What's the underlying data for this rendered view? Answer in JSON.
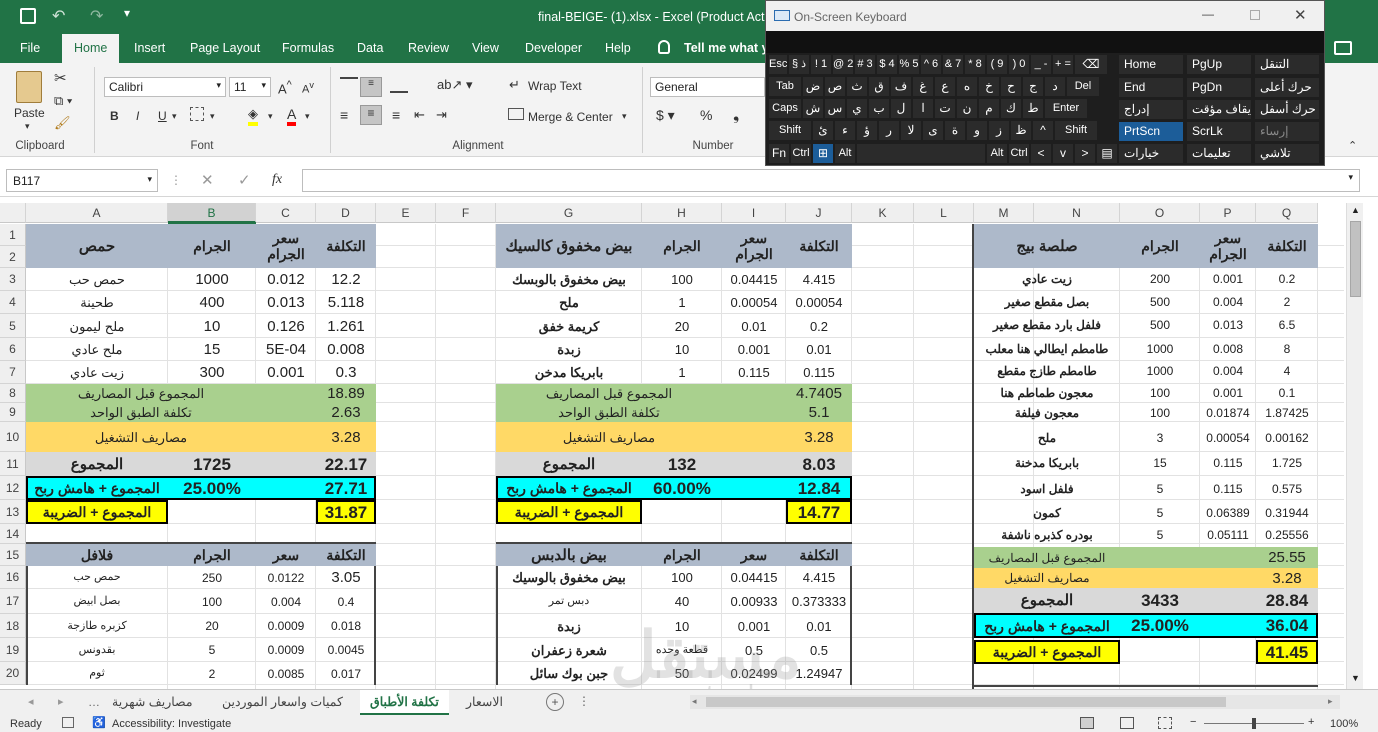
{
  "title_bar": {
    "title": "final-BEIGE- (1).xlsx  -  Excel (Product Activ"
  },
  "menu": [
    "File",
    "Home",
    "Insert",
    "Page Layout",
    "Formulas",
    "Data",
    "Review",
    "View",
    "Developer",
    "Help",
    "Tell me what yo"
  ],
  "ribbon": {
    "font_name": "Calibri",
    "font_size": "11",
    "wrap_text": "Wrap Text",
    "merge_center": "Merge & Center",
    "number_format": "General",
    "paste": "Paste",
    "bold": "B",
    "italic": "I",
    "underline": "U",
    "groups": {
      "clipboard": "Clipboard",
      "font": "Font",
      "alignment": "Alignment",
      "number": "Number"
    }
  },
  "formula_bar": {
    "name_box": "B117",
    "fx": "fx",
    "value": ""
  },
  "osk": {
    "title": "On-Screen Keyboard",
    "rows": [
      [
        "Esc",
        "§ ذ",
        "! 1",
        "@ 2",
        "# 3",
        "$ 4",
        "% 5",
        "^ 6",
        "& 7",
        "* 8",
        "( 9",
        ") 0",
        "_ -",
        "+ =",
        "⌫"
      ],
      [
        "Tab",
        "ض",
        "ص",
        "ث",
        "ق",
        "ف",
        "غ",
        "ع",
        "ه",
        "خ",
        "ح",
        "ج",
        "د",
        "Del"
      ],
      [
        "Caps",
        "ش",
        "س",
        "ي",
        "ب",
        "ل",
        "ا",
        "ت",
        "ن",
        "م",
        "ك",
        "ط",
        "Enter"
      ],
      [
        "Shift",
        "ئ",
        "ء",
        "ؤ",
        "ر",
        "لا",
        "ى",
        "ة",
        "و",
        "ز",
        "ظ",
        "^",
        "Shift"
      ],
      [
        "Fn",
        "Ctrl",
        "⊞",
        "Alt",
        "",
        "Alt",
        "Ctrl",
        "<",
        "v",
        ">",
        "▤"
      ]
    ],
    "nav": [
      [
        "Home",
        "PgUp",
        "التنقل"
      ],
      [
        "End",
        "PgDn",
        "حرك أعلى"
      ],
      [
        "إدراج",
        "إيقاف مؤقت",
        "حرك أسفل"
      ],
      [
        "PrtScn",
        "ScrLk",
        "إرساء"
      ],
      [
        "خيارات",
        "تعليمات",
        "تلاشي"
      ]
    ]
  },
  "columns": [
    {
      "l": "A",
      "w": 142
    },
    {
      "l": "B",
      "w": 88
    },
    {
      "l": "C",
      "w": 60
    },
    {
      "l": "D",
      "w": 60
    },
    {
      "l": "E",
      "w": 60
    },
    {
      "l": "F",
      "w": 60
    },
    {
      "l": "G",
      "w": 146
    },
    {
      "l": "H",
      "w": 80
    },
    {
      "l": "I",
      "w": 64
    },
    {
      "l": "J",
      "w": 66
    },
    {
      "l": "K",
      "w": 62
    },
    {
      "l": "L",
      "w": 60
    },
    {
      "l": "M",
      "w": 60
    },
    {
      "l": "N",
      "w": 86
    },
    {
      "l": "O",
      "w": 80
    },
    {
      "l": "P",
      "w": 56
    },
    {
      "l": "Q",
      "w": 62
    }
  ],
  "rows": [
    "1",
    "2",
    "3",
    "4",
    "5",
    "6",
    "7",
    "8",
    "9",
    "10",
    "11",
    "12",
    "13",
    "14",
    "15",
    "16",
    "17",
    "18",
    "19",
    "20"
  ],
  "block_hummus": {
    "header": {
      "name": "حمص",
      "gram": "الجرام",
      "price": "سعر\nالجرام",
      "cost": "التكلفة"
    },
    "items": [
      [
        "حمص حب",
        "1000",
        "0.012",
        "12.2"
      ],
      [
        "طحينة",
        "400",
        "0.013",
        "5.118"
      ],
      [
        "ملح ليمون",
        "10",
        "0.126",
        "1.261"
      ],
      [
        "ملح عادي",
        "15",
        "5E-04",
        "0.008"
      ],
      [
        "زيت عادي",
        "300",
        "0.001",
        "0.3"
      ]
    ],
    "before_exp": {
      "label": "المجموع قبل المصاريف",
      "value": "18.89"
    },
    "per_plate": {
      "label": "تكلفة الطبق الواحد",
      "value": "2.63"
    },
    "op_exp": {
      "label": "مصاريف التشغيل",
      "value": "3.28"
    },
    "total": {
      "label": "المجموع",
      "gram": "1725",
      "value": "22.17"
    },
    "margin": {
      "label": "المجموع + هامش ربح",
      "pct": "25.00%",
      "value": "27.71"
    },
    "tax": {
      "label": "المجموع + الضريبة",
      "value": "31.87"
    }
  },
  "block_eggs": {
    "header": {
      "name": "بيض مخفوق كالسيك",
      "gram": "الجرام",
      "price": "سعر\nالجرام",
      "cost": "التكلفة"
    },
    "items": [
      [
        "بيض مخفوق بالوبسك",
        "100",
        "0.04415",
        "4.415"
      ],
      [
        "ملح",
        "1",
        "0.00054",
        "0.00054"
      ],
      [
        "كريمة خفق",
        "20",
        "0.01",
        "0.2"
      ],
      [
        "زبدة",
        "10",
        "0.001",
        "0.01"
      ],
      [
        "بابريكا مدخن",
        "1",
        "0.115",
        "0.115"
      ]
    ],
    "before_exp": {
      "label": "المجموع قبل المصاريف",
      "value": "4.7405"
    },
    "per_plate": {
      "label": "تكلفة الطبق الواحد",
      "value": "5.1"
    },
    "op_exp": {
      "label": "مصاريف التشغيل",
      "value": "3.28"
    },
    "total": {
      "label": "المجموع",
      "gram": "132",
      "value": "8.03"
    },
    "margin": {
      "label": "المجموع + هامش ربح",
      "pct": "60.00%",
      "value": "12.84"
    },
    "tax": {
      "label": "المجموع + الضريبة",
      "value": "14.77"
    }
  },
  "block_salsa": {
    "header": {
      "name": "صلصة بيج",
      "gram": "الجرام",
      "price": "سعر\nالجرام",
      "cost": "التكلفة"
    },
    "items": [
      [
        "زيت عادي",
        "200",
        "0.001",
        "0.2"
      ],
      [
        "بصل مقطع صغير",
        "500",
        "0.004",
        "2"
      ],
      [
        "فلفل بارد مقطع صغير",
        "500",
        "0.013",
        "6.5"
      ],
      [
        "طامطم ايطالي هنا معلب",
        "1000",
        "0.008",
        "8"
      ],
      [
        "طامطم طازج مقطع",
        "1000",
        "0.004",
        "4"
      ],
      [
        "معجون طماطم هنا",
        "100",
        "0.001",
        "0.1"
      ],
      [
        "معجون فيلفة",
        "100",
        "0.01874",
        "1.87425"
      ],
      [
        "ملح",
        "3",
        "0.00054",
        "0.00162"
      ],
      [
        "بابريكا مدخنة",
        "15",
        "0.115",
        "1.725"
      ],
      [
        "فلفل اسود",
        "5",
        "0.115",
        "0.575"
      ],
      [
        "كمون",
        "5",
        "0.06389",
        "0.31944"
      ],
      [
        "بودره كذبره ناشفة",
        "5",
        "0.05111",
        "0.25556"
      ]
    ],
    "before_exp": {
      "label": "المجموع قبل المصاريف",
      "value": "25.55"
    },
    "op_exp": {
      "label": "مصاريف التشغيل",
      "value": "3.28"
    },
    "total": {
      "label": "المجموع",
      "gram": "3433",
      "value": "28.84"
    },
    "margin": {
      "label": "المجموع + هامش ربح",
      "pct": "25.00%",
      "value": "36.04"
    },
    "tax": {
      "label": "المجموع + الضريبة",
      "value": "41.45"
    }
  },
  "block_falafel": {
    "header": {
      "name": "فلافل",
      "gram": "الجرام",
      "price": "سعر",
      "cost": "التكلفة"
    },
    "items": [
      [
        "حمص حب",
        "250",
        "0.0122",
        "3.05"
      ],
      [
        "بصل ابيض",
        "100",
        "0.004",
        "0.4"
      ],
      [
        "كزبره طازجة",
        "20",
        "0.0009",
        "0.018"
      ],
      [
        "بقدونس",
        "5",
        "0.0009",
        "0.0045"
      ],
      [
        "ثوم",
        "2",
        "0.0085",
        "0.017"
      ]
    ]
  },
  "block_eggs_molasses": {
    "header": {
      "name": "بيض بالدبس",
      "gram": "الجرام",
      "price": "سعر",
      "cost": "التكلفة"
    },
    "items": [
      [
        "بيض مخفوق بالوسيك",
        "100",
        "0.04415",
        "4.415"
      ],
      [
        "دبس تمر",
        "40",
        "0.00933",
        "0.373333"
      ],
      [
        "زبدة",
        "10",
        "0.001",
        "0.01"
      ],
      [
        "شعرة زعفران",
        "قطعة وحده",
        "0.5",
        "0.5"
      ],
      [
        "جبن بوك سائل",
        "50",
        "0.02499",
        "1.24947"
      ]
    ]
  },
  "watermark": {
    "brand": "مستقل",
    "url": "mostaql.com"
  },
  "sheet_tabs": [
    "مصاريف شهرية",
    "كميات واسعار الموردين",
    "تكلفة الأطباق",
    "الاسعار"
  ],
  "active_tab": "تكلفة الأطباق",
  "status": {
    "ready": "Ready",
    "accessibility": "Accessibility: Investigate",
    "zoom": "100%"
  },
  "colors": {
    "excel_green": "#217346",
    "header_blue": "#adb9ca",
    "green_row": "#a9d08e",
    "orange_row": "#ffd966",
    "cyan_row": "#00ffff",
    "yellow_row": "#ffff00",
    "gray_row": "#d9d9d9"
  }
}
